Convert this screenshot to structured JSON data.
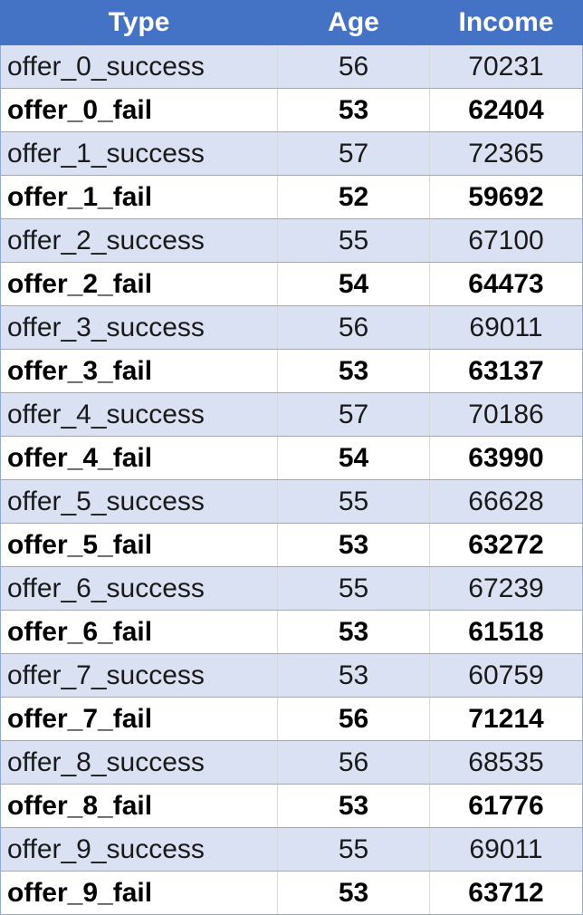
{
  "table": {
    "headers": {
      "type": "Type",
      "age": "Age",
      "income": "Income"
    },
    "rows": [
      {
        "type": "offer_0_success",
        "age": "56",
        "income": "70231"
      },
      {
        "type": "offer_0_fail",
        "age": "53",
        "income": "62404"
      },
      {
        "type": "offer_1_success",
        "age": "57",
        "income": "72365"
      },
      {
        "type": "offer_1_fail",
        "age": "52",
        "income": "59692"
      },
      {
        "type": "offer_2_success",
        "age": "55",
        "income": "67100"
      },
      {
        "type": "offer_2_fail",
        "age": "54",
        "income": "64473"
      },
      {
        "type": "offer_3_success",
        "age": "56",
        "income": "69011"
      },
      {
        "type": "offer_3_fail",
        "age": "53",
        "income": "63137"
      },
      {
        "type": "offer_4_success",
        "age": "57",
        "income": "70186"
      },
      {
        "type": "offer_4_fail",
        "age": "54",
        "income": "63990"
      },
      {
        "type": "offer_5_success",
        "age": "55",
        "income": "66628"
      },
      {
        "type": "offer_5_fail",
        "age": "53",
        "income": "63272"
      },
      {
        "type": "offer_6_success",
        "age": "55",
        "income": "67239"
      },
      {
        "type": "offer_6_fail",
        "age": "53",
        "income": "61518"
      },
      {
        "type": "offer_7_success",
        "age": "53",
        "income": "60759"
      },
      {
        "type": "offer_7_fail",
        "age": "56",
        "income": "71214"
      },
      {
        "type": "offer_8_success",
        "age": "56",
        "income": "68535"
      },
      {
        "type": "offer_8_fail",
        "age": "53",
        "income": "61776"
      },
      {
        "type": "offer_9_success",
        "age": "55",
        "income": "69011"
      },
      {
        "type": "offer_9_fail",
        "age": "53",
        "income": "63712"
      }
    ]
  },
  "colors": {
    "header_bg": "#4472c4",
    "header_text": "#ffffff",
    "band_row_bg": "#d9e1f2",
    "plain_row_bg": "#ffffff",
    "row_border": "#8eaadb"
  }
}
